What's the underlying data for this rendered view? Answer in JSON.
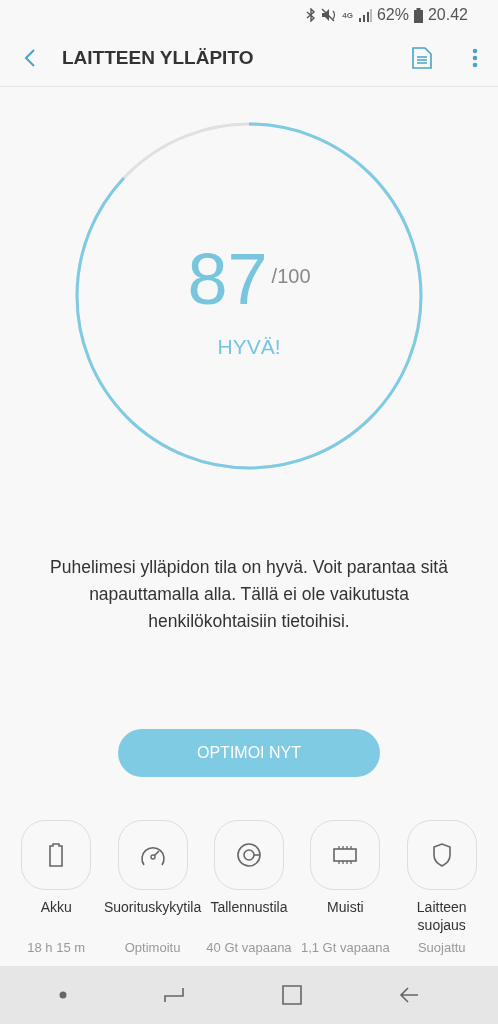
{
  "status_bar": {
    "network": "4G",
    "battery": "62%",
    "time": "20.42"
  },
  "app_bar": {
    "title": "LAITTEEN YLLÄPITO"
  },
  "score": {
    "value": "87",
    "max": "/100",
    "rating": "HYVÄ!"
  },
  "description": "Puhelimesi ylläpidon tila on hyvä. Voit parantaa sitä napauttamalla alla. Tällä ei ole vaikutusta henkilökohtaisiin tietoihisi.",
  "action_button": "OPTIMOI NYT",
  "tiles": [
    {
      "kind": "battery",
      "label": "Akku",
      "status": "18 h 15 m"
    },
    {
      "kind": "performance",
      "label": "Suorituskykytila",
      "status": "Optimoitu"
    },
    {
      "kind": "storage",
      "label": "Tallennustila",
      "status": "40 Gt vapaana"
    },
    {
      "kind": "memory",
      "label": "Muisti",
      "status": "1,1 Gt vapaana"
    },
    {
      "kind": "security",
      "label": "Laitteen suojaus",
      "status": "Suojattu"
    }
  ]
}
